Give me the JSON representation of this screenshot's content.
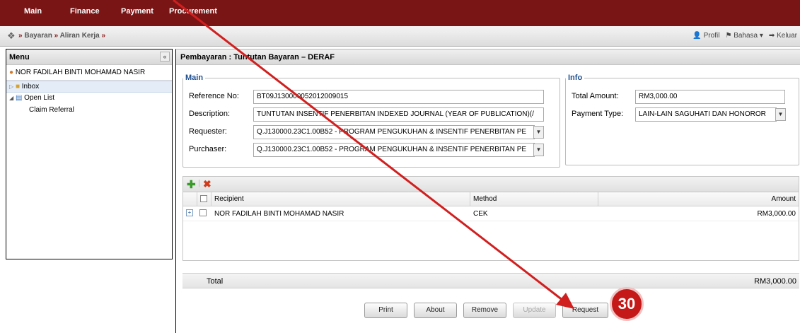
{
  "topnav": {
    "items": [
      "Main",
      "Finance",
      "Payment",
      "Procurement"
    ]
  },
  "breadcrumb": {
    "items": [
      "Bayaran",
      "Aliran Kerja"
    ],
    "separator": "»"
  },
  "toplinks": {
    "profile": "Profil",
    "language": "Bahasa",
    "logout": "Keluar"
  },
  "sidebar": {
    "title": "Menu",
    "collapse": "«",
    "user": "NOR FADILAH BINTI MOHAMAD NASIR",
    "items": [
      {
        "label": "Inbox"
      },
      {
        "label": "Open List"
      },
      {
        "label": "Claim Referral"
      }
    ]
  },
  "page": {
    "title": "Pembayaran : Tuntutan Bayaran – DERAF"
  },
  "main_fieldset": {
    "legend": "Main",
    "reference_label": "Reference No:",
    "reference_value": "BT09J130000052012009015",
    "description_label": "Description:",
    "description_value": "TUNTUTAN INSENTIF PENERBITAN INDEXED JOURNAL  (YEAR OF PUBLICATION)(/",
    "requester_label": "Requester:",
    "requester_value": "Q.J130000.23C1.00B52 - PROGRAM PENGUKUHAN & INSENTIF PENERBITAN PE",
    "purchaser_label": "Purchaser:",
    "purchaser_value": "Q.J130000.23C1.00B52 - PROGRAM PENGUKUHAN & INSENTIF PENERBITAN PE"
  },
  "info_fieldset": {
    "legend": "Info",
    "total_amount_label": "Total Amount:",
    "total_amount_value": "RM3,000.00",
    "payment_type_label": "Payment Type:",
    "payment_type_value": "LAIN-LAIN SAGUHATI DAN HONOROR"
  },
  "grid": {
    "columns": [
      "Recipient",
      "Method",
      "Amount"
    ],
    "rows": [
      {
        "recipient": "NOR FADILAH BINTI MOHAMAD NASIR",
        "method": "CEK",
        "amount": "RM3,000.00"
      }
    ],
    "total_label": "Total",
    "total_value": "RM3,000.00"
  },
  "buttons": {
    "print": "Print",
    "about": "About",
    "remove": "Remove",
    "update": "Update",
    "request": "Request"
  },
  "annotation": {
    "step": "30",
    "color": "#c51919"
  },
  "colors": {
    "topbar": "#7a1515",
    "legend": "#1f4f8f"
  }
}
